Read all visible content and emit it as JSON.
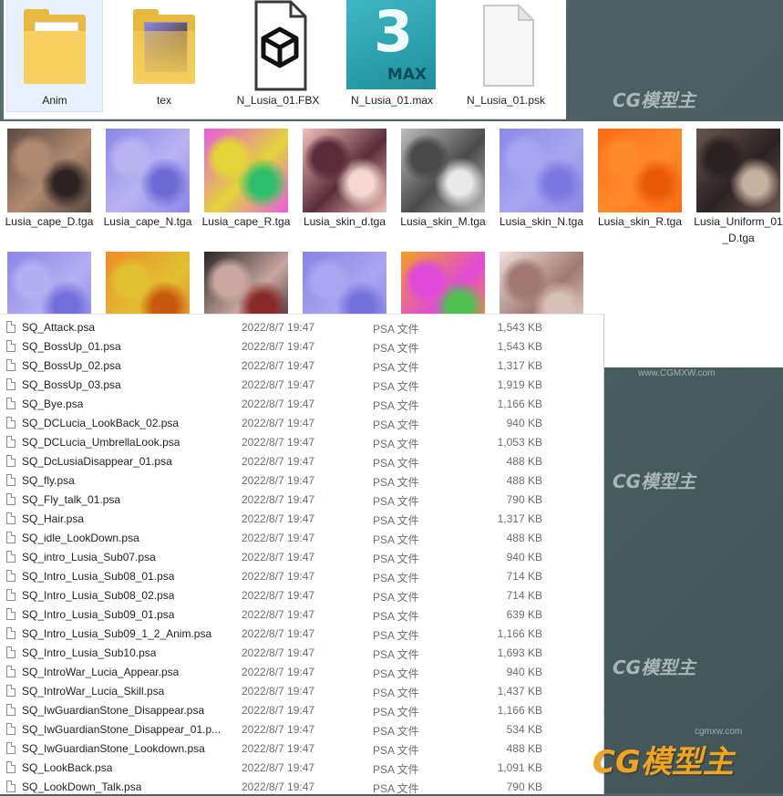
{
  "top_items": [
    {
      "label": "Anim",
      "icon": "folder-icon"
    },
    {
      "label": "tex",
      "icon": "folder-texture-icon"
    },
    {
      "label": "N_Lusia_01.FBX",
      "icon": "fbx-file-icon"
    },
    {
      "label": "N_Lusia_01.max",
      "icon": "3dsmax-file-icon",
      "glyph": "3",
      "word": "MAX"
    },
    {
      "label": "N_Lusia_01.psk",
      "icon": "blank-file-icon"
    }
  ],
  "textures": [
    {
      "label": "Lusia_cape_D.tga",
      "colors": [
        "#5a4a44",
        "#b08a70",
        "#2c2222"
      ]
    },
    {
      "label": "Lusia_cape_N.tga",
      "colors": [
        "#8a86e8",
        "#b9b3f2",
        "#6d6bd6"
      ]
    },
    {
      "label": "Lusia_cape_R.tga",
      "colors": [
        "#e85ae0",
        "#e4d43a",
        "#2dbf6a"
      ]
    },
    {
      "label": "Lusia_skin_d.tga",
      "colors": [
        "#f2c0b8",
        "#5a2c3a",
        "#f6d8d0"
      ]
    },
    {
      "label": "Lusia_skin_M.tga",
      "colors": [
        "#bdbdbd",
        "#4a4a4a",
        "#e8e8e8"
      ]
    },
    {
      "label": "Lusia_skin_N.tga",
      "colors": [
        "#8b88ea",
        "#a9a6f0",
        "#7a78e0"
      ]
    },
    {
      "label": "Lusia_skin_R.tga",
      "colors": [
        "#ff6a12",
        "#ff8a2a",
        "#e85a08"
      ]
    },
    {
      "label": "Lusia_Uniform_01_D.tga",
      "colors": [
        "#6a5650",
        "#2a2222",
        "#c8b0a0"
      ]
    },
    {
      "label": "",
      "colors": [
        "#8a86e8",
        "#b4aef2",
        "#7370dc"
      ]
    },
    {
      "label": "",
      "colors": [
        "#f08a2a",
        "#e0c030",
        "#c85a10"
      ]
    },
    {
      "label": "",
      "colors": [
        "#2a2426",
        "#c8a8a0",
        "#8a2a2a"
      ]
    },
    {
      "label": "",
      "colors": [
        "#8784e6",
        "#aaa6f0",
        "#7672dc"
      ]
    },
    {
      "label": "",
      "colors": [
        "#f0a020",
        "#e04ad8",
        "#50c050"
      ]
    },
    {
      "label": "",
      "colors": [
        "#f0e0dc",
        "#a07870",
        "#d8c0b8"
      ]
    }
  ],
  "files": [
    {
      "name": "SQ_Attack.psa",
      "date": "2022/8/7 19:47",
      "type": "PSA 文件",
      "size": "1,543 KB"
    },
    {
      "name": "SQ_BossUp_01.psa",
      "date": "2022/8/7 19:47",
      "type": "PSA 文件",
      "size": "1,543 KB"
    },
    {
      "name": "SQ_BossUp_02.psa",
      "date": "2022/8/7 19:47",
      "type": "PSA 文件",
      "size": "1,317 KB"
    },
    {
      "name": "SQ_BossUp_03.psa",
      "date": "2022/8/7 19:47",
      "type": "PSA 文件",
      "size": "1,919 KB"
    },
    {
      "name": "SQ_Bye.psa",
      "date": "2022/8/7 19:47",
      "type": "PSA 文件",
      "size": "1,166 KB"
    },
    {
      "name": "SQ_DCLucia_LookBack_02.psa",
      "date": "2022/8/7 19:47",
      "type": "PSA 文件",
      "size": "940 KB"
    },
    {
      "name": "SQ_DCLucia_UmbrellaLook.psa",
      "date": "2022/8/7 19:47",
      "type": "PSA 文件",
      "size": "1,053 KB"
    },
    {
      "name": "SQ_DcLusiaDisappear_01.psa",
      "date": "2022/8/7 19:47",
      "type": "PSA 文件",
      "size": "488 KB"
    },
    {
      "name": "SQ_fly.psa",
      "date": "2022/8/7 19:47",
      "type": "PSA 文件",
      "size": "488 KB"
    },
    {
      "name": "SQ_Fly_talk_01.psa",
      "date": "2022/8/7 19:47",
      "type": "PSA 文件",
      "size": "790 KB"
    },
    {
      "name": "SQ_Hair.psa",
      "date": "2022/8/7 19:47",
      "type": "PSA 文件",
      "size": "1,317 KB"
    },
    {
      "name": "SQ_idle_LookDown.psa",
      "date": "2022/8/7 19:47",
      "type": "PSA 文件",
      "size": "488 KB"
    },
    {
      "name": "SQ_intro_Lusia_Sub07.psa",
      "date": "2022/8/7 19:47",
      "type": "PSA 文件",
      "size": "940 KB"
    },
    {
      "name": "SQ_Intro_Lusia_Sub08_01.psa",
      "date": "2022/8/7 19:47",
      "type": "PSA 文件",
      "size": "714 KB"
    },
    {
      "name": "SQ_Intro_Lusia_Sub08_02.psa",
      "date": "2022/8/7 19:47",
      "type": "PSA 文件",
      "size": "714 KB"
    },
    {
      "name": "SQ_Intro_Lusia_Sub09_01.psa",
      "date": "2022/8/7 19:47",
      "type": "PSA 文件",
      "size": "639 KB"
    },
    {
      "name": "SQ_Intro_Lusia_Sub09_1_2_Anim.psa",
      "date": "2022/8/7 19:47",
      "type": "PSA 文件",
      "size": "1,166 KB"
    },
    {
      "name": "SQ_Intro_Lusia_Sub10.psa",
      "date": "2022/8/7 19:47",
      "type": "PSA 文件",
      "size": "1,693 KB"
    },
    {
      "name": "SQ_IntroWar_Lucia_Appear.psa",
      "date": "2022/8/7 19:47",
      "type": "PSA 文件",
      "size": "940 KB"
    },
    {
      "name": "SQ_IntroWar_Lucia_Skill.psa",
      "date": "2022/8/7 19:47",
      "type": "PSA 文件",
      "size": "1,437 KB"
    },
    {
      "name": "SQ_IwGuardianStone_Disappear.psa",
      "date": "2022/8/7 19:47",
      "type": "PSA 文件",
      "size": "1,166 KB"
    },
    {
      "name": "SQ_IwGuardianStone_Disappear_01.p...",
      "date": "2022/8/7 19:47",
      "type": "PSA 文件",
      "size": "534 KB"
    },
    {
      "name": "SQ_IwGuardianStone_Lookdown.psa",
      "date": "2022/8/7 19:47",
      "type": "PSA 文件",
      "size": "488 KB"
    },
    {
      "name": "SQ_LookBack.psa",
      "date": "2022/8/7 19:47",
      "type": "PSA 文件",
      "size": "1,091 KB"
    },
    {
      "name": "SQ_LookDown_Talk.psa",
      "date": "2022/8/7 19:47",
      "type": "PSA 文件",
      "size": "790 KB"
    }
  ],
  "watermark": {
    "brand": "CG模型主",
    "url": "www.CGMXW.com",
    "url_small": "cgmxw.com"
  }
}
